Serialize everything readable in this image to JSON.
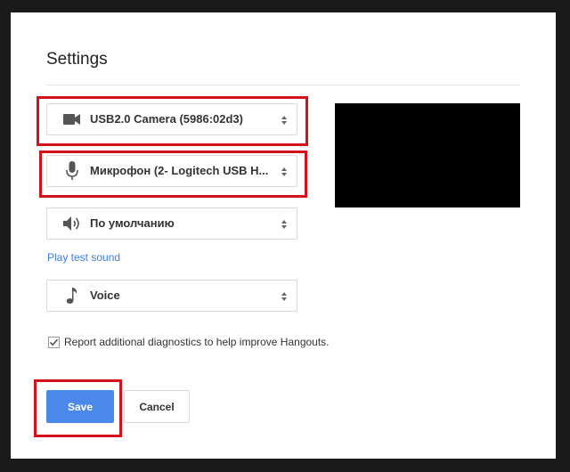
{
  "dialog": {
    "title": "Settings"
  },
  "camera": {
    "icon": "video-camera-icon",
    "value": "USB2.0 Camera (5986:02d3)"
  },
  "microphone": {
    "icon": "microphone-icon",
    "value": "Микрофон (2- Logitech USB H..."
  },
  "speaker": {
    "icon": "speaker-icon",
    "value": "По умолчанию"
  },
  "play_test_sound": "Play test sound",
  "ringtone": {
    "icon": "music-note-icon",
    "value": "Voice"
  },
  "diagnostics": {
    "checked": true,
    "label": "Report additional diagnostics to help improve Hangouts."
  },
  "buttons": {
    "save": "Save",
    "cancel": "Cancel"
  },
  "colors": {
    "accent": "#4a89ea",
    "highlight": "#d4101b",
    "link": "#3b7de0",
    "video_preview": "#000000"
  }
}
